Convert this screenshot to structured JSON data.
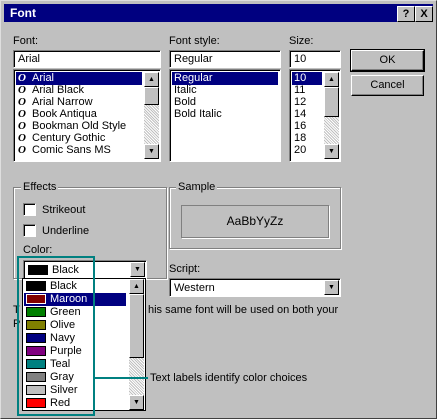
{
  "dialog": {
    "title": "Font",
    "help_button": "?",
    "close_button": "X"
  },
  "font": {
    "label": "Font:",
    "value": "Arial",
    "items": [
      "Arial",
      "Arial Black",
      "Arial Narrow",
      "Book Antiqua",
      "Bookman Old Style",
      "Century Gothic",
      "Comic Sans MS"
    ],
    "icon": "truetype-icon",
    "icon_glyph": "O"
  },
  "font_style": {
    "label": "Font style:",
    "value": "Regular",
    "items": [
      "Regular",
      "Italic",
      "Bold",
      "Bold Italic"
    ]
  },
  "size": {
    "label": "Size:",
    "value": "10",
    "items": [
      "10",
      "11",
      "12",
      "14",
      "16",
      "18",
      "20"
    ]
  },
  "buttons": {
    "ok": "OK",
    "cancel": "Cancel"
  },
  "effects": {
    "title": "Effects",
    "strikeout": "Strikeout",
    "underline": "Underline",
    "color_label": "Color:",
    "color_value": "Black"
  },
  "sample": {
    "title": "Sample",
    "text": "AaBbYyZz"
  },
  "script": {
    "label": "Script:",
    "value": "Western"
  },
  "info_text_part1": "T",
  "info_text_part2": "his same font will be used on both your",
  "info_text_part3": "P",
  "colors": {
    "items": [
      {
        "name": "Black",
        "hex": "#000000"
      },
      {
        "name": "Maroon",
        "hex": "#800000"
      },
      {
        "name": "Green",
        "hex": "#008000"
      },
      {
        "name": "Olive",
        "hex": "#808000"
      },
      {
        "name": "Navy",
        "hex": "#000080"
      },
      {
        "name": "Purple",
        "hex": "#800080"
      },
      {
        "name": "Teal",
        "hex": "#008080"
      },
      {
        "name": "Gray",
        "hex": "#808080"
      },
      {
        "name": "Silver",
        "hex": "#c0c0c0"
      },
      {
        "name": "Red",
        "hex": "#ff0000"
      }
    ],
    "selected": "Maroon"
  },
  "annotation": "Text labels identify color choices",
  "accent": "#008080"
}
